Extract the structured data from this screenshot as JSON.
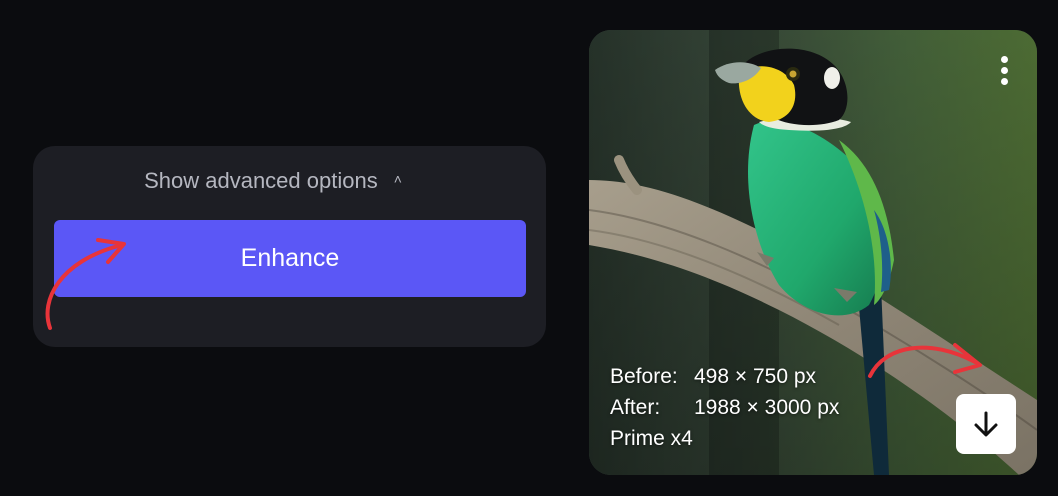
{
  "options_panel": {
    "advanced_toggle_label": "Show advanced options",
    "toggle_chevron": "chevron-up-icon",
    "enhance_label": "Enhance"
  },
  "image_card": {
    "menu_icon": "more-vertical-icon",
    "info": {
      "before_label": "Before:",
      "before_value": "498 × 750 px",
      "after_label": "After:",
      "after_value": "1988 × 3000 px",
      "model": "Prime x4"
    },
    "download_icon": "arrow-down-icon"
  },
  "colors": {
    "background": "#0b0c0f",
    "panel": "#1d1e24",
    "accent": "#5b57f6",
    "annotation": "#e8343a"
  }
}
